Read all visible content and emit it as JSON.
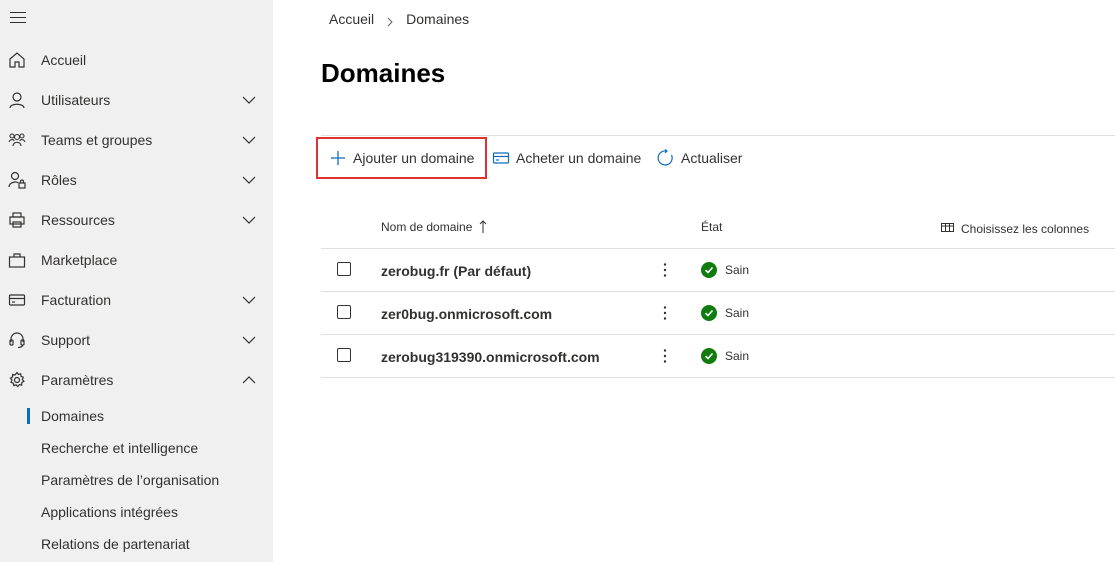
{
  "sidebar": {
    "items": [
      {
        "label": "Accueil",
        "icon": "home-icon",
        "expandable": false
      },
      {
        "label": "Utilisateurs",
        "icon": "person-icon",
        "expandable": true
      },
      {
        "label": "Teams et groupes",
        "icon": "people-icon",
        "expandable": true
      },
      {
        "label": "Rôles",
        "icon": "person-lock-icon",
        "expandable": true
      },
      {
        "label": "Ressources",
        "icon": "printer-icon",
        "expandable": true
      },
      {
        "label": "Marketplace",
        "icon": "bag-icon",
        "expandable": false
      },
      {
        "label": "Facturation",
        "icon": "credit-card-icon",
        "expandable": true
      },
      {
        "label": "Support",
        "icon": "headset-icon",
        "expandable": true
      },
      {
        "label": "Paramètres",
        "icon": "gear-icon",
        "expandable": true,
        "expanded": true
      }
    ],
    "sub_items": [
      {
        "label": "Domaines",
        "selected": true
      },
      {
        "label": "Recherche et intelligence"
      },
      {
        "label": "Paramètres de l’organisation"
      },
      {
        "label": "Applications intégrées"
      },
      {
        "label": "Relations de partenariat"
      }
    ]
  },
  "breadcrumb": {
    "root": "Accueil",
    "current": "Domaines"
  },
  "page": {
    "title": "Domaines"
  },
  "toolbar": {
    "add_label": "Ajouter un domaine",
    "buy_label": "Acheter un domaine",
    "refresh_label": "Actualiser"
  },
  "table": {
    "col_domain": "Nom de domaine",
    "col_state": "État",
    "choose_columns": "Choisissez les colonnes",
    "rows": [
      {
        "domain": "zerobug.fr (Par défaut)",
        "state": "Sain"
      },
      {
        "domain": "zer0bug.onmicrosoft.com",
        "state": "Sain"
      },
      {
        "domain": "zerobug319390.onmicrosoft.com",
        "state": "Sain"
      }
    ]
  },
  "colors": {
    "accent": "#0f6cbd",
    "success": "#107c10",
    "highlight": "#e03232"
  }
}
